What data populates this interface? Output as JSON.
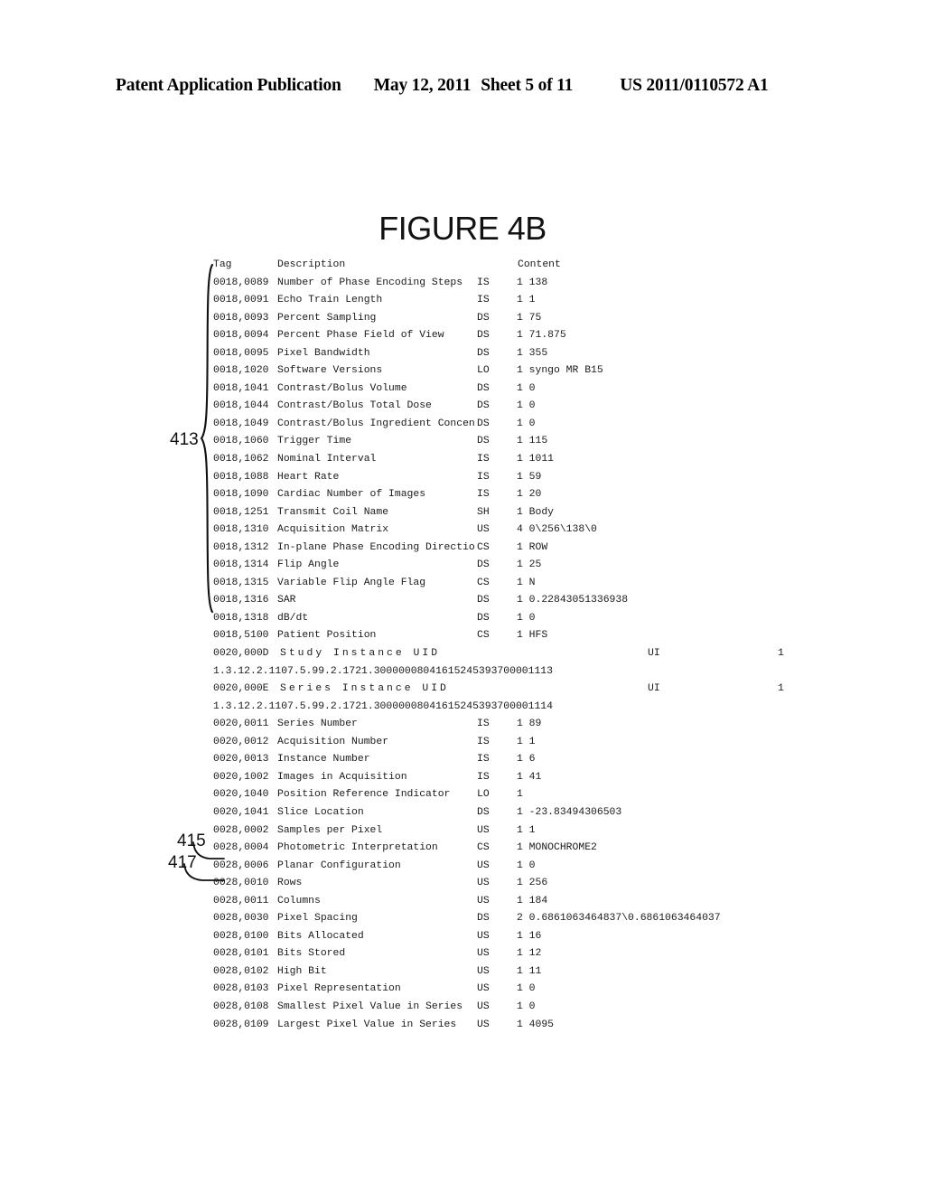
{
  "header": {
    "publication": "Patent Application Publication",
    "date": "May 12, 2011",
    "sheet": "Sheet 5 of 11",
    "doc_number": "US 2011/0110572 A1"
  },
  "figure": {
    "title": "FIGURE 4B"
  },
  "table": {
    "columns": {
      "tag": "Tag",
      "description": "Description",
      "content": "Content"
    },
    "rows": [
      {
        "tag": "0018,0089",
        "description": "Number of Phase Encoding Steps",
        "vr": "IS",
        "content": "1 138"
      },
      {
        "tag": "0018,0091",
        "description": "Echo Train Length",
        "vr": "IS",
        "content": "1 1"
      },
      {
        "tag": "0018,0093",
        "description": "Percent Sampling",
        "vr": "DS",
        "content": "1 75"
      },
      {
        "tag": "0018,0094",
        "description": "Percent Phase Field of View",
        "vr": "DS",
        "content": "1 71.875"
      },
      {
        "tag": "0018,0095",
        "description": "Pixel Bandwidth",
        "vr": "DS",
        "content": "1 355"
      },
      {
        "tag": "0018,1020",
        "description": "Software Versions",
        "vr": "LO",
        "content": "1 syngo MR B15"
      },
      {
        "tag": "0018,1041",
        "description": "Contrast/Bolus Volume",
        "vr": "DS",
        "content": "1 0"
      },
      {
        "tag": "0018,1044",
        "description": "Contrast/Bolus Total Dose",
        "vr": "DS",
        "content": "1 0"
      },
      {
        "tag": "0018,1049",
        "description": "Contrast/Bolus Ingredient Concen",
        "vr": "DS",
        "content": "1 0"
      },
      {
        "tag": "0018,1060",
        "description": "Trigger Time",
        "vr": "DS",
        "content": "1 115"
      },
      {
        "tag": "0018,1062",
        "description": "Nominal Interval",
        "vr": "IS",
        "content": "1 1011"
      },
      {
        "tag": "0018,1088",
        "description": "Heart Rate",
        "vr": "IS",
        "content": "1 59"
      },
      {
        "tag": "0018,1090",
        "description": "Cardiac Number of Images",
        "vr": "IS",
        "content": "1 20"
      },
      {
        "tag": "0018,1251",
        "description": "Transmit Coil Name",
        "vr": "SH",
        "content": "1 Body"
      },
      {
        "tag": "0018,1310",
        "description": "Acquisition Matrix",
        "vr": "US",
        "content": "4 0\\256\\138\\0"
      },
      {
        "tag": "0018,1312",
        "description": "In-plane Phase Encoding Directio",
        "vr": "CS",
        "content": "1 ROW"
      },
      {
        "tag": "0018,1314",
        "description": "Flip Angle",
        "vr": "DS",
        "content": "1 25"
      },
      {
        "tag": "0018,1315",
        "description": "Variable Flip Angle Flag",
        "vr": "CS",
        "content": "1 N"
      },
      {
        "tag": "0018,1316",
        "description": "SAR",
        "vr": "DS",
        "content": "1 0.22843051336938"
      },
      {
        "tag": "0018,1318",
        "description": "dB/dt",
        "vr": "DS",
        "content": "1 0"
      },
      {
        "tag": "0018,5100",
        "description": "Patient Position",
        "vr": "CS",
        "content": "1 HFS"
      },
      {
        "tag": "0020,000D",
        "description": "Study Instance UID",
        "vr": "UI",
        "vm": "1",
        "uid": true
      },
      {
        "uid_value": "1.3.12.2.1107.5.99.2.1721.30000008041615245393700001113"
      },
      {
        "tag": "0020,000E",
        "description": "Series Instance UID",
        "vr": "UI",
        "vm": "1",
        "uid": true
      },
      {
        "uid_value": "1.3.12.2.1107.5.99.2.1721.30000008041615245393700001114"
      },
      {
        "tag": "0020,0011",
        "description": "Series Number",
        "vr": "IS",
        "content": "1 89"
      },
      {
        "tag": "0020,0012",
        "description": "Acquisition Number",
        "vr": "IS",
        "content": "1 1"
      },
      {
        "tag": "0020,0013",
        "description": "Instance Number",
        "vr": "IS",
        "content": "1 6"
      },
      {
        "tag": "0020,1002",
        "description": "Images in Acquisition",
        "vr": "IS",
        "content": "1 41"
      },
      {
        "tag": "0020,1040",
        "description": "Position Reference Indicator",
        "vr": "LO",
        "content": "1"
      },
      {
        "tag": "0020,1041",
        "description": "Slice Location",
        "vr": "DS",
        "content": "1 -23.83494306503"
      },
      {
        "tag": "0028,0002",
        "description": "Samples per Pixel",
        "vr": "US",
        "content": "1 1"
      },
      {
        "tag": "0028,0004",
        "description": "Photometric Interpretation",
        "vr": "CS",
        "content": "1 MONOCHROME2"
      },
      {
        "tag": "0028,0006",
        "description": "Planar Configuration",
        "vr": "US",
        "content": "1 0"
      },
      {
        "tag": "0028,0010",
        "description": "Rows",
        "vr": "US",
        "content": "1 256"
      },
      {
        "tag": "0028,0011",
        "description": "Columns",
        "vr": "US",
        "content": "1 184"
      },
      {
        "tag": "0028,0030",
        "description": "Pixel Spacing",
        "vr": "DS",
        "content": "2 0.6861063464837\\0.6861063464037"
      },
      {
        "tag": "0028,0100",
        "description": "Bits Allocated",
        "vr": "US",
        "content": "1 16"
      },
      {
        "tag": "0028,0101",
        "description": "Bits Stored",
        "vr": "US",
        "content": "1 12"
      },
      {
        "tag": "0028,0102",
        "description": "High Bit",
        "vr": "US",
        "content": "1 11"
      },
      {
        "tag": "0028,0103",
        "description": "Pixel Representation",
        "vr": "US",
        "content": "1 0"
      },
      {
        "tag": "0028,0108",
        "description": "Smallest Pixel Value in Series",
        "vr": "US",
        "content": "1 0"
      },
      {
        "tag": "0028,0109",
        "description": "Largest Pixel Value in Series",
        "vr": "US",
        "content": "1 4095"
      }
    ]
  },
  "reference_numerals": {
    "group_413": "413",
    "rows_415": "415",
    "columns_417": "417"
  }
}
